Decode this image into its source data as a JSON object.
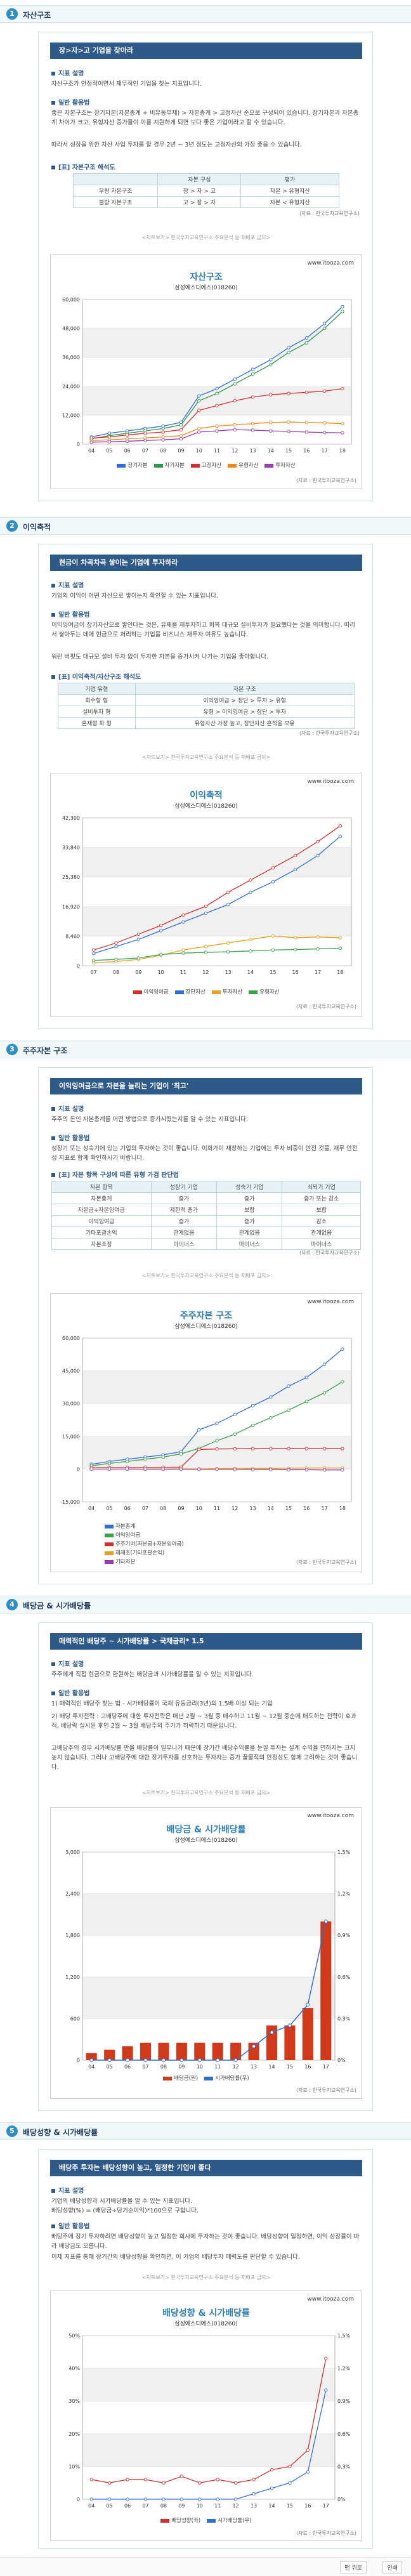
{
  "sections": [
    {
      "num": "1",
      "title": "자산구조",
      "banner": "장>자>고 기업을 찾아라",
      "sub1": "지표 설명",
      "p1": "자산구조가 안정적이면서 재무적인 기업을 찾는 지표입니다.",
      "sub2": "일반 활용법",
      "p2": "좋은 자본구조는 장기자본(자본총계 + 비유동부채) > 자본총계 > 고정자산 순으로 구성되어 있습니다. 장기자본과 자본총계 차이가 크고, 유형자산 증가율이 이를 지원하게 되면 보다 좋은 기업이라고 할 수 있습니다.",
      "p3": "따라서 성장을 위한 자산 사업 투자를 할 경우 2년 ~ 3년 정도는 고정자산의 가장 좋을 수 있습니다.",
      "table_title": "[표] 자본구조 해석도",
      "table_headers": [
        "",
        "자본 구성",
        "평가"
      ],
      "table_rows": [
        [
          "우량 자본구조",
          "장 > 자 > 고",
          "자본 > 유형자산"
        ],
        [
          "불량 자본구조",
          "고 > 장 > 자",
          "자본 < 유형자산"
        ]
      ],
      "table_source": "(자료 : 한국투자교육연구소)",
      "note": "<차트보기> 한국투자교육연구소 주요분석 등 재배포 금지>",
      "chart": {
        "title": "자산구조",
        "subtitle": "삼성에스디에스(018260)",
        "site": "www.itooza.com",
        "source": "(자료 : 한국투자교육연구소)"
      }
    },
    {
      "num": "2",
      "title": "이익축적",
      "banner": "현금이 차곡차곡 쌓이는 기업에 투자하라",
      "sub1": "지표 설명",
      "p1": "기업의 이익이 어떤 자산으로 쌓이는지 확인할 수 있는 지표입니다.",
      "sub2": "일반 활용법",
      "p2": "이익잉여금이 장기자산으로 쌓인다는 것은, 유재을 재투자하고 회복 대규모 설비투자가 필요했다는 것을 의미합니다. 따라서 쌓아두는 데에 현금으로 처리하는 기업을 비즈니스 재투자 여유도 높습니다.",
      "p3": "워런 버핏도 대규모 설비 투자 없이 투자한 자본을 증가시켜 나가는 기업을 좋아합니다.",
      "table_title": "[표] 이익축적/자산구조 해석도",
      "table_headers": [
        "기업 유형",
        "자본 구조"
      ],
      "table_rows": [
        [
          "회수형 형",
          "이익잉여금 > 장단 > 투자 > 유형"
        ],
        [
          "설비투자 형",
          "유형 > 이익잉여금 > 장단 > 투자"
        ],
        [
          "혼재형 화 형",
          "유형자산 가장 높고, 장단자산 흔적을 보유"
        ]
      ],
      "table_source": "(자료 : 한국투자교육연구소)",
      "note": "<차트보기> 한국투자교육연구소 주요분석 등 재배포 금지>",
      "chart": {
        "title": "이익축적",
        "subtitle": "삼성에스디에스(018260)",
        "site": "www.itooza.com",
        "source": "(자료 : 한국투자교육연구소)"
      }
    },
    {
      "num": "3",
      "title": "주주자본 구조",
      "banner": "이익잉여금으로 자본을 늘리는 기업이 '최고'",
      "sub1": "지표 설명",
      "p1": "주주의 돈인 자본총계를 어떤 방법으로 증가시켰는지를 알 수 있는 지표입니다.",
      "sub2": "일반 활용법",
      "p2": "성장기 또는 성숙기에 있는 기업의 투자하는 것이 좋습니다. 이회가이 재창하는 기업에는 투자 비중이 안전 것을, 재무 안전성 지표로 함께 확인하시기 바랍니다.",
      "table_title": "[표] 자본 항목 구성에 따른 유형 가검 판단법",
      "table_headers": [
        "자본 항목",
        "성장기 기업",
        "성숙기 기업",
        "쇠퇴기 기업"
      ],
      "table_rows": [
        [
          "자본총계",
          "증가",
          "증가",
          "증가 또는 감소"
        ],
        [
          "자본금+자본잉여금",
          "제한적 증가",
          "보합",
          "보합"
        ],
        [
          "이익잉여금",
          "증가",
          "증가",
          "감소"
        ],
        [
          "기타포괄손익",
          "관계없음",
          "관계없음",
          "관계없음"
        ],
        [
          "자본조정",
          "마이너스",
          "마이너스",
          "마이너스"
        ]
      ],
      "table_source": "(자료 : 한국투자교육연구소)",
      "note": "<차트보기> 한국투자교육연구소 주요분석 등 재배포 금지>",
      "chart": {
        "title": "주주자본 구조",
        "subtitle": "삼성에스디에스(018260)",
        "site": "www.itooza.com",
        "source": "(자료 : 한국투자교육연구소)"
      }
    },
    {
      "num": "4",
      "title": "배당금 & 시가배당률",
      "banner": "매력적인 배당주 ~ 시가배당률 > 국채금리* 1.5",
      "sub1": "지표 설명",
      "p1": "주주에게 직접 현금으로 환원하는 배당금과 시가배당률을 알 수 있는 지표입니다.",
      "sub2": "일반 활용법",
      "p2": "1) 매력적인 배당주 찾는 법 - 시가배당률이 국채 유동금리(3년)의 1.5배 이상 되는 기업",
      "p3": "2) 배당 투자전략 : 고배당주에 대한 투자전략은 매년 2월 ~ 3월 중 매수하고 11월 ~ 12월 중순에 매도하는 전략이 효과적, 배당락 실시된 후인 2월 ~ 3월 배당주의 주가가 하락하기 때문입니다.",
      "p4": "고배당주의 경우 시가배당률 만을 배당률이 일부나가 때문에 장기간 배당수익률을 눈낄 투자는 설계 수익을 연하지는 크지 높지 않습니다. 그러나 고배당주에 대한 장기투자를 선호하는 투자자는 증가 꿀물적의 안정성도 함께 고려하는 것이 좋습니다.",
      "note": "<차트보기> 한국투자교육연구소 주요분석 등 재배포 금지>",
      "chart": {
        "title": "배당금 & 시가배당률",
        "subtitle": "삼성에스디에스(018260)",
        "site": "www.itooza.com",
        "source": "(자료 : 한국투자교육연구소)"
      }
    },
    {
      "num": "5",
      "title": "배당성향 & 시가배당률",
      "banner": "배당주 투자는 배당성향이 높고, 일정한 기업이 좋다",
      "sub1": "지표 설명",
      "p1": "기업의 배당성향과 시가배당률을 알 수 있는 지표입니다.",
      "p1b": "배당성향(%) = (배당금÷당기순이익)*100으로 구합니다.",
      "sub2": "일반 활용법",
      "p2": "배당주에 장기 투자하려면 배당성향이 높고 일정한 회사에 투자하는 것이 좋습니다. 배당성향이 일정하면, 이익 성장률이 따라 배당금도 오릅니다.",
      "p3": "이제 지표를 통해 장기간의 배당성향을 확인하면, 이 기업의 배당투자 매력도를 판단할 수 있습니다.",
      "note": "<차트보기> 한국투자교육연구소 주요분석 등 재배포 금지>",
      "chart": {
        "title": "배당성향 & 시가배당률",
        "subtitle": "삼성에스디에스(018260)",
        "site": "www.itooza.com",
        "source": "(자료 : 한국투자교육연구소)"
      }
    }
  ],
  "chart_data": [
    {
      "type": "line",
      "title": "자산구조",
      "x": [
        "04",
        "05",
        "06",
        "07",
        "08",
        "09",
        "10",
        "11",
        "12",
        "13",
        "14",
        "15",
        "16",
        "17",
        "18"
      ],
      "ylim": [
        0,
        60000
      ],
      "yticks": [
        "0",
        "12,000",
        "24,000",
        "36,000",
        "48,000",
        "60,000"
      ],
      "series": [
        {
          "name": "장기자본",
          "color": "#2f6fd0",
          "values": [
            3000,
            4500,
            5500,
            6500,
            7500,
            9000,
            20000,
            23000,
            27000,
            31000,
            35000,
            40000,
            44000,
            50000,
            57000
          ]
        },
        {
          "name": "자기자본",
          "color": "#2a9a4a",
          "values": [
            2200,
            3500,
            4500,
            5500,
            6500,
            8000,
            18000,
            21000,
            25000,
            29000,
            33000,
            38000,
            42000,
            48000,
            55000
          ]
        },
        {
          "name": "고정자산",
          "color": "#d03030",
          "values": [
            2500,
            3000,
            3800,
            4500,
            5000,
            6000,
            14000,
            16000,
            18000,
            19500,
            20500,
            21000,
            21500,
            22000,
            23000
          ]
        },
        {
          "name": "유형자산",
          "color": "#e88a20",
          "values": [
            1500,
            1800,
            2200,
            2600,
            3000,
            3500,
            6500,
            7500,
            8000,
            8500,
            9000,
            9200,
            9000,
            8800,
            8500
          ]
        },
        {
          "name": "투자자산",
          "color": "#9a3ab0",
          "values": [
            800,
            1000,
            1200,
            1500,
            1800,
            2200,
            5000,
            5500,
            6000,
            5800,
            5500,
            5300,
            5000,
            4800,
            4700
          ]
        }
      ],
      "legend": [
        "장기자본",
        "자기자본",
        "고정자산",
        "유형자산",
        "투자자산"
      ]
    },
    {
      "type": "line",
      "title": "이익축적",
      "x": [
        "07",
        "08",
        "09",
        "10",
        "11",
        "12",
        "13",
        "14",
        "15",
        "16",
        "17",
        "18"
      ],
      "ylim": [
        0,
        42300
      ],
      "yticks": [
        "0",
        "8,460",
        "16,920",
        "25,380",
        "33,840",
        "42,300"
      ],
      "series": [
        {
          "name": "이익잉여금",
          "color": "#d03030",
          "values": [
            4500,
            6500,
            9000,
            11500,
            14500,
            17000,
            21000,
            24500,
            28000,
            31500,
            35500,
            40000
          ]
        },
        {
          "name": "장단자산",
          "color": "#2f6fd0",
          "values": [
            3500,
            5500,
            7500,
            10000,
            12500,
            15000,
            17500,
            21000,
            24000,
            27500,
            31500,
            37000
          ]
        },
        {
          "name": "투자자산",
          "color": "#e8a020",
          "values": [
            800,
            1200,
            1800,
            3000,
            4500,
            5500,
            6500,
            7500,
            8500,
            8000,
            8200,
            8000
          ]
        },
        {
          "name": "유형자산",
          "color": "#3aa050",
          "values": [
            1500,
            1800,
            2200,
            3200,
            3600,
            3800,
            4000,
            4200,
            4500,
            4600,
            4800,
            5000
          ]
        }
      ],
      "legend": [
        "이익잉여금",
        "장단자산",
        "투자자산",
        "유형자산"
      ]
    },
    {
      "type": "line",
      "title": "주주자본 구조",
      "x": [
        "04",
        "05",
        "06",
        "07",
        "08",
        "09",
        "10",
        "11",
        "12",
        "13",
        "14",
        "15",
        "16",
        "17",
        "18"
      ],
      "ylim": [
        -15000,
        60000
      ],
      "yticks": [
        "-15,000",
        "0",
        "15,000",
        "30,000",
        "45,000",
        "60,000"
      ],
      "series": [
        {
          "name": "자본총계",
          "color": "#2f6fd0",
          "values": [
            2200,
            3500,
            4500,
            5500,
            6500,
            8000,
            18000,
            21000,
            25000,
            29000,
            33000,
            38000,
            42000,
            48000,
            55000
          ]
        },
        {
          "name": "이익잉여금",
          "color": "#3aa050",
          "values": [
            1500,
            2600,
            3500,
            4500,
            5500,
            7000,
            9500,
            13000,
            16000,
            20000,
            23500,
            27000,
            31000,
            35000,
            40000
          ]
        },
        {
          "name": "주주기여(자본금+자본잉여금)",
          "color": "#d03030",
          "values": [
            700,
            700,
            700,
            800,
            800,
            900,
            9000,
            9200,
            9300,
            9400,
            9400,
            9400,
            9400,
            9400,
            9400
          ]
        },
        {
          "name": "재재조(기타포괄손익)",
          "color": "#e8a020",
          "values": [
            0,
            0,
            0,
            50,
            50,
            100,
            100,
            200,
            300,
            300,
            300,
            400,
            500,
            500,
            500
          ]
        },
        {
          "name": "기타자본",
          "color": "#9a3ab0",
          "values": [
            0,
            0,
            0,
            -50,
            -50,
            -50,
            -100,
            -100,
            -100,
            -200,
            -200,
            -300,
            -300,
            -400,
            -400
          ]
        }
      ],
      "legend": [
        "자본총계",
        "이익잉여금",
        "주주기여(자본금+자본잉여금)",
        "재재조(기타포괄손익)",
        "기타자본"
      ]
    },
    {
      "type": "bar",
      "title": "배당금 & 시가배당률",
      "categories": [
        "04",
        "05",
        "06",
        "07",
        "08",
        "09",
        "10",
        "11",
        "12",
        "13",
        "14",
        "15",
        "16",
        "17"
      ],
      "ylim": [
        0,
        3000
      ],
      "yticks": [
        "0",
        "600",
        "1,200",
        "1,800",
        "2,400",
        "3,000"
      ],
      "y2lim": [
        0,
        1.5
      ],
      "y2ticks": [
        "0%",
        "0.3%",
        "0.6%",
        "0.9%",
        "1.2%",
        "1.5%"
      ],
      "series": [
        {
          "name": "배당금(원)",
          "color": "#d03a1a",
          "values": [
            100,
            150,
            200,
            250,
            250,
            250,
            250,
            250,
            250,
            250,
            500,
            500,
            750,
            2000
          ]
        },
        {
          "name": "시가배당률(우)",
          "color": "#2f6fd0",
          "values": [
            0.0,
            0.0,
            0.0,
            0.0,
            0.0,
            0.0,
            0.0,
            0.0,
            0.0,
            0.1,
            0.2,
            0.25,
            0.4,
            1.0
          ]
        }
      ],
      "legend": [
        "배당금(원)",
        "시가배당률(우)"
      ]
    },
    {
      "type": "line",
      "title": "배당성향 & 시가배당률",
      "x": [
        "04",
        "05",
        "06",
        "07",
        "08",
        "09",
        "10",
        "11",
        "12",
        "13",
        "14",
        "15",
        "16",
        "17"
      ],
      "ylim": [
        0,
        50
      ],
      "yticks": [
        "0",
        "10%",
        "20%",
        "30%",
        "40%",
        "50%"
      ],
      "y2lim": [
        0,
        1.5
      ],
      "y2ticks": [
        "0%",
        "0.3%",
        "0.6%",
        "0.9%",
        "1.2%",
        "1.5%"
      ],
      "series": [
        {
          "name": "배당성향(좌)",
          "color": "#d03030",
          "values": [
            6,
            5,
            6,
            6,
            5,
            7,
            5,
            6,
            5,
            6,
            9,
            10,
            15,
            43
          ]
        },
        {
          "name": "시가배당률(우)",
          "color": "#2f6fd0",
          "values": [
            0,
            0,
            0,
            0,
            0,
            0,
            0,
            0,
            0,
            0.05,
            0.1,
            0.15,
            0.25,
            1.0
          ]
        }
      ],
      "legend": [
        "배당성향(좌)",
        "시가배당률(우)"
      ]
    }
  ],
  "footer": {
    "top_label": "맨 위로",
    "print_label": "인쇄"
  }
}
